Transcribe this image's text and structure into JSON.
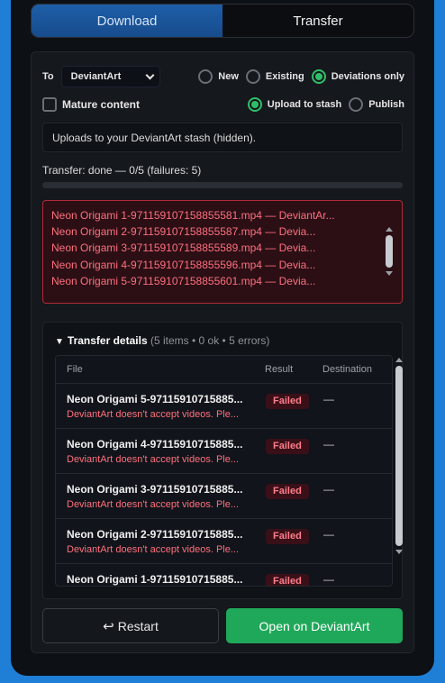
{
  "tabs": [
    {
      "label": "Download",
      "active": true
    },
    {
      "label": "Transfer",
      "active": false
    }
  ],
  "destination": {
    "to_label": "To",
    "selected": "DeviantArt",
    "modes": [
      {
        "label": "New",
        "selected": false
      },
      {
        "label": "Existing",
        "selected": false
      },
      {
        "label": "Deviations only",
        "selected": true
      }
    ]
  },
  "options": {
    "mature_label": "Mature content",
    "mature_checked": false,
    "publish_modes": [
      {
        "label": "Upload to stash",
        "selected": true
      },
      {
        "label": "Publish",
        "selected": false
      }
    ]
  },
  "info": "Uploads to your DeviantArt stash (hidden).",
  "status": {
    "text": "Transfer: done — 0/5 (failures: 5)",
    "progress": 0
  },
  "errors": [
    "Neon Origami 1-971159107158855581.mp4 — DeviantAr...",
    "Neon Origami 2-971159107158855587.mp4 — Devia...",
    "Neon Origami 3-971159107158855589.mp4 — Devia...",
    "Neon Origami 4-971159107158855596.mp4 — Devia...",
    "Neon Origami 5-971159107158855601.mp4 — Devia..."
  ],
  "details": {
    "toggle": "▼",
    "title": "Transfer details",
    "summary": "(5 items • 0 ok • 5 errors)",
    "columns": [
      "File",
      "Result",
      "Destination"
    ],
    "rows": [
      {
        "file": "Neon Origami 5-97115910715885...",
        "message": "DeviantArt doesn't accept videos. Ple...",
        "result": "Failed",
        "destination": "—"
      },
      {
        "file": "Neon Origami 4-97115910715885...",
        "message": "DeviantArt doesn't accept videos. Ple...",
        "result": "Failed",
        "destination": "—"
      },
      {
        "file": "Neon Origami 3-97115910715885...",
        "message": "DeviantArt doesn't accept videos. Ple...",
        "result": "Failed",
        "destination": "—"
      },
      {
        "file": "Neon Origami 2-97115910715885...",
        "message": "DeviantArt doesn't accept videos. Ple...",
        "result": "Failed",
        "destination": "—"
      },
      {
        "file": "Neon Origami 1-97115910715885...",
        "message": "",
        "result": "Failed",
        "destination": "—"
      }
    ]
  },
  "buttons": {
    "restart_icon": "↩",
    "restart": "Restart",
    "open": "Open on DeviantArt"
  },
  "colors": {
    "accent_blue": "#1f7fd6",
    "success_green": "#20a85a",
    "error_red": "#ff6f7e"
  }
}
